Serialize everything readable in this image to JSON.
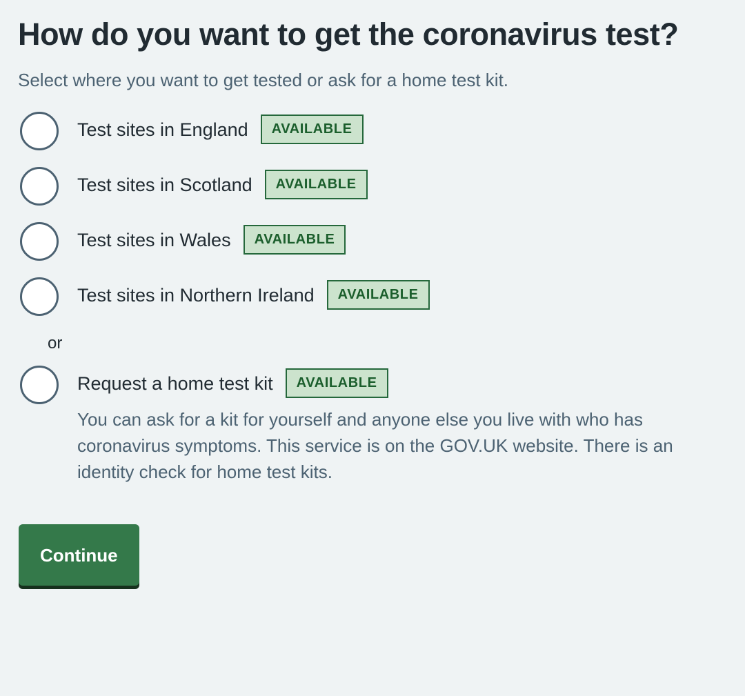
{
  "page": {
    "title": "How do you want to get the coronavirus test?",
    "subtitle": "Select where you want to get tested or ask for a home test kit.",
    "background_color": "#eff3f4",
    "heading_color": "#212b32",
    "secondary_text_color": "#4c6272"
  },
  "options": [
    {
      "label": "Test sites in England",
      "tag": "AVAILABLE",
      "selected": false,
      "hint": ""
    },
    {
      "label": "Test sites in Scotland",
      "tag": "AVAILABLE",
      "selected": false,
      "hint": ""
    },
    {
      "label": "Test sites in Wales",
      "tag": "AVAILABLE",
      "selected": false,
      "hint": ""
    },
    {
      "label": "Test sites in Northern Ireland",
      "tag": "AVAILABLE",
      "selected": false,
      "hint": ""
    },
    {
      "label": "Request a home test kit",
      "tag": "AVAILABLE",
      "selected": false,
      "hint": "You can ask for a kit for yourself and anyone else you live with who has coronavirus symptoms. This service is on the GOV.UK website. There is an identity check for home test kits."
    }
  ],
  "divider": {
    "label": "or",
    "after_index": 3
  },
  "tag_style": {
    "background_color": "#cce3cd",
    "border_color": "#25683b",
    "text_color": "#1b5e2c"
  },
  "actions": {
    "continue_label": "Continue",
    "continue_color": "#34794a",
    "continue_shadow_color": "#16301d"
  }
}
